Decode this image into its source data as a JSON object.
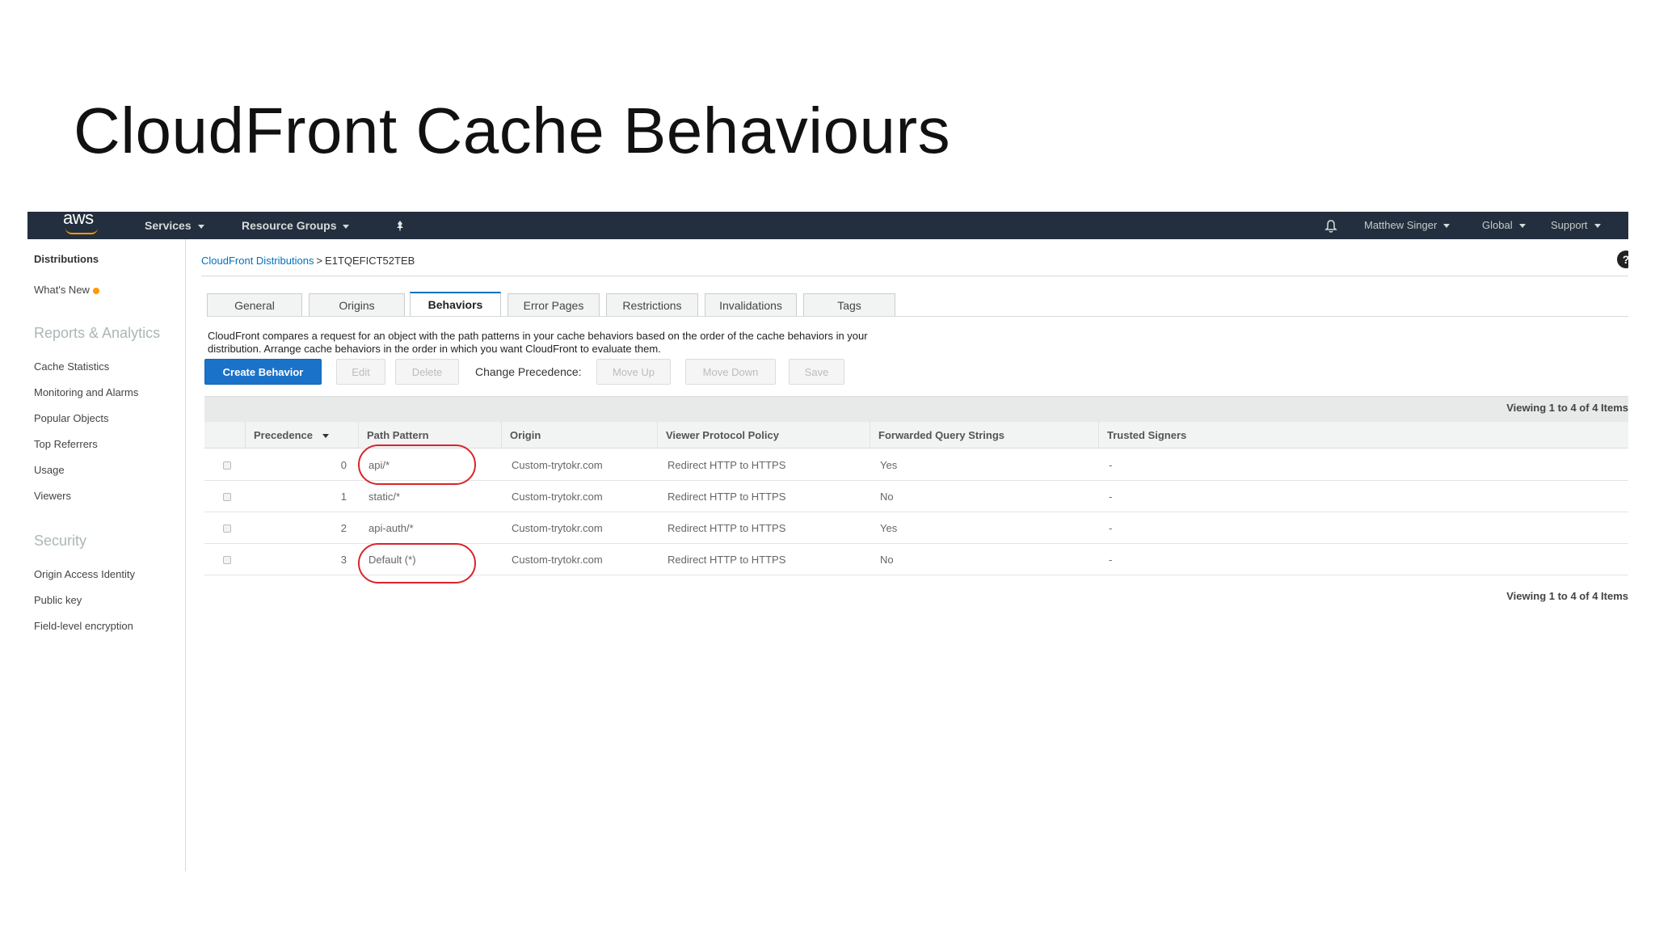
{
  "slide": {
    "title": "CloudFront Cache Behaviours"
  },
  "topnav": {
    "logo": "aws",
    "services": "Services",
    "resource_groups": "Resource Groups",
    "pin_icon": "pin-icon",
    "bell_icon": "bell-icon",
    "user": "Matthew Singer",
    "region": "Global",
    "support": "Support"
  },
  "sidebar": {
    "distributions": "Distributions",
    "whats_new": "What's New",
    "reports_heading": "Reports & Analytics",
    "reports_items": [
      "Cache Statistics",
      "Monitoring and Alarms",
      "Popular Objects",
      "Top Referrers",
      "Usage",
      "Viewers"
    ],
    "security_heading": "Security",
    "security_items": [
      "Origin Access Identity",
      "Public key",
      "Field-level encryption"
    ]
  },
  "breadcrumb": {
    "parent": "CloudFront Distributions",
    "separator": ">",
    "current": "E1TQEFICT52TEB"
  },
  "help_icon": "help-icon",
  "tabs": [
    "General",
    "Origins",
    "Behaviors",
    "Error Pages",
    "Restrictions",
    "Invalidations",
    "Tags"
  ],
  "active_tab": "Behaviors",
  "description": "CloudFront compares a request for an object with the path patterns in your cache behaviors based on the order of the cache behaviors in your distribution. Arrange cache behaviors in the order in which you want CloudFront to evaluate them.",
  "toolbar": {
    "create": "Create Behavior",
    "edit": "Edit",
    "delete": "Delete",
    "change_precedence": "Change Precedence:",
    "move_up": "Move Up",
    "move_down": "Move Down",
    "save": "Save"
  },
  "viewing_text": "Viewing 1 to 4 of 4 Items",
  "table": {
    "columns": [
      "Precedence",
      "Path Pattern",
      "Origin",
      "Viewer Protocol Policy",
      "Forwarded Query Strings",
      "Trusted Signers"
    ],
    "rows": [
      {
        "precedence": "0",
        "path": "api/*",
        "origin": "Custom-trytokr.com",
        "policy": "Redirect HTTP to HTTPS",
        "query": "Yes",
        "signers": "-"
      },
      {
        "precedence": "1",
        "path": "static/*",
        "origin": "Custom-trytokr.com",
        "policy": "Redirect HTTP to HTTPS",
        "query": "No",
        "signers": "-"
      },
      {
        "precedence": "2",
        "path": "api-auth/*",
        "origin": "Custom-trytokr.com",
        "policy": "Redirect HTTP to HTTPS",
        "query": "Yes",
        "signers": "-"
      },
      {
        "precedence": "3",
        "path": "Default (*)",
        "origin": "Custom-trytokr.com",
        "policy": "Redirect HTTP to HTTPS",
        "query": "No",
        "signers": "-"
      }
    ]
  },
  "colors": {
    "nav_bg": "#232f3e",
    "primary_button": "#1a73c9",
    "annotation": "#d9242b",
    "link": "#0073bb"
  }
}
